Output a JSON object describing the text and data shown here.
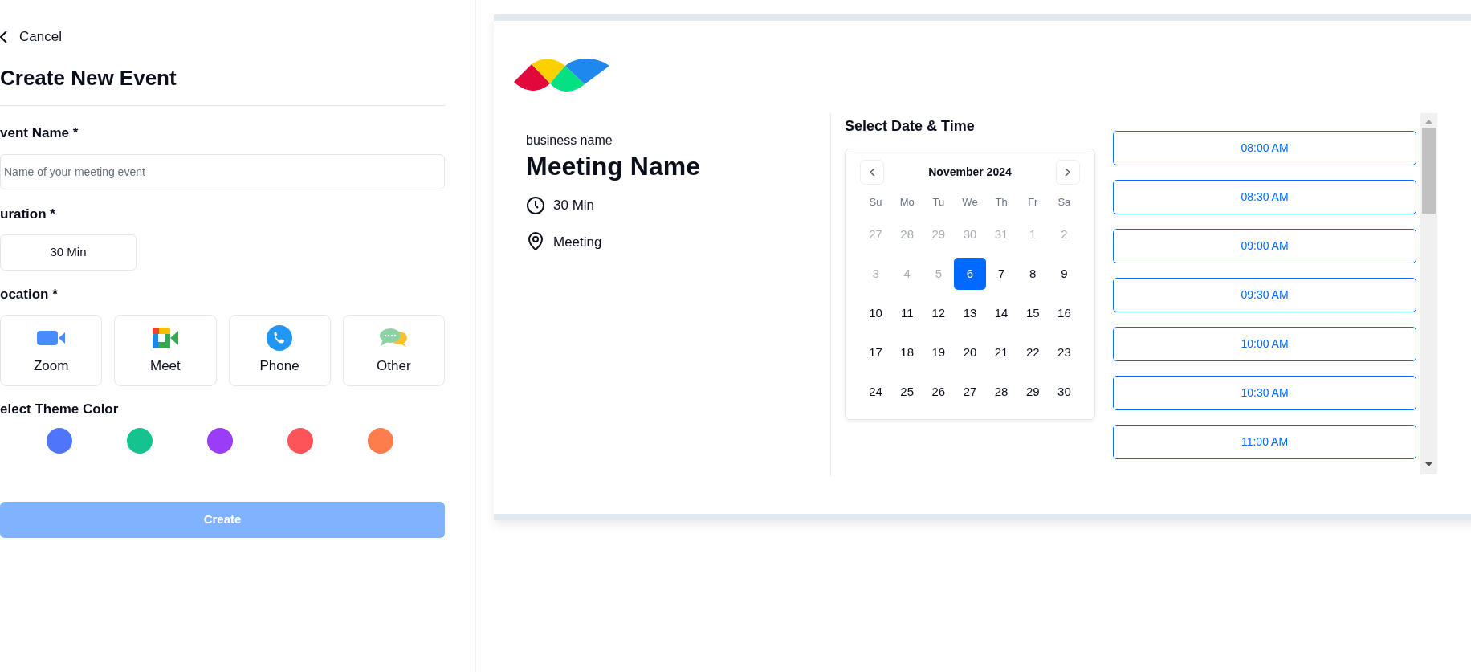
{
  "editor": {
    "back_link": "Cancel",
    "title": "Create New Event",
    "event_name": {
      "label": "vent Name *",
      "placeholder": "Name of your meeting event"
    },
    "duration": {
      "label": "uration *",
      "value": "30 Min"
    },
    "location": {
      "label": "ocation *",
      "options": [
        {
          "kind": "zoom",
          "label": "Zoom",
          "selected": false
        },
        {
          "kind": "meet",
          "label": "Meet",
          "selected": false
        },
        {
          "kind": "phone",
          "label": "Phone",
          "selected": false
        },
        {
          "kind": "other",
          "label": "Other",
          "selected": false
        }
      ]
    },
    "theme": {
      "label": "elect Theme Color",
      "colors": [
        {
          "color": "#4f75fb"
        },
        {
          "color": "#14c38e"
        },
        {
          "color": "#9b3cf8"
        },
        {
          "color": "#fd5459"
        },
        {
          "color": "#fe7d4d"
        }
      ]
    },
    "create_button": {
      "label": "Create",
      "disabled": true
    }
  },
  "preview": {
    "business_name": "business name",
    "meeting_name": "Meeting Name",
    "details": [
      {
        "kind": "clock",
        "text": "30 Min"
      },
      {
        "kind": "pin",
        "text": "Meeting"
      }
    ],
    "heading": "Select Date & Time",
    "calendar": {
      "month": "November 2024",
      "weekdays": [
        "Su",
        "Mo",
        "Tu",
        "We",
        "Th",
        "Fr",
        "Sa"
      ],
      "weeks": [
        [
          {
            "label": "27",
            "muted": true,
            "selected": false
          },
          {
            "label": "28",
            "muted": true,
            "selected": false
          },
          {
            "label": "29",
            "muted": true,
            "selected": false
          },
          {
            "label": "30",
            "muted": true,
            "selected": false
          },
          {
            "label": "31",
            "muted": true,
            "selected": false
          },
          {
            "label": "1",
            "muted": true,
            "selected": false
          },
          {
            "label": "2",
            "muted": true,
            "selected": false
          }
        ],
        [
          {
            "label": "3",
            "muted": true,
            "selected": false
          },
          {
            "label": "4",
            "muted": true,
            "selected": false
          },
          {
            "label": "5",
            "muted": true,
            "selected": false
          },
          {
            "label": "6",
            "muted": false,
            "selected": true
          },
          {
            "label": "7",
            "muted": false,
            "selected": false
          },
          {
            "label": "8",
            "muted": false,
            "selected": false
          },
          {
            "label": "9",
            "muted": false,
            "selected": false
          }
        ],
        [
          {
            "label": "10",
            "muted": false,
            "selected": false
          },
          {
            "label": "11",
            "muted": false,
            "selected": false
          },
          {
            "label": "12",
            "muted": false,
            "selected": false
          },
          {
            "label": "13",
            "muted": false,
            "selected": false
          },
          {
            "label": "14",
            "muted": false,
            "selected": false
          },
          {
            "label": "15",
            "muted": false,
            "selected": false
          },
          {
            "label": "16",
            "muted": false,
            "selected": false
          }
        ],
        [
          {
            "label": "17",
            "muted": false,
            "selected": false
          },
          {
            "label": "18",
            "muted": false,
            "selected": false
          },
          {
            "label": "19",
            "muted": false,
            "selected": false
          },
          {
            "label": "20",
            "muted": false,
            "selected": false
          },
          {
            "label": "21",
            "muted": false,
            "selected": false
          },
          {
            "label": "22",
            "muted": false,
            "selected": false
          },
          {
            "label": "23",
            "muted": false,
            "selected": false
          }
        ],
        [
          {
            "label": "24",
            "muted": false,
            "selected": false
          },
          {
            "label": "25",
            "muted": false,
            "selected": false
          },
          {
            "label": "26",
            "muted": false,
            "selected": false
          },
          {
            "label": "27",
            "muted": false,
            "selected": false
          },
          {
            "label": "28",
            "muted": false,
            "selected": false
          },
          {
            "label": "29",
            "muted": false,
            "selected": false
          },
          {
            "label": "30",
            "muted": false,
            "selected": false
          }
        ]
      ]
    },
    "time_slots": [
      "08:00 AM",
      "08:30 AM",
      "09:00 AM",
      "09:30 AM",
      "10:00 AM",
      "10:30 AM",
      "11:00 AM"
    ]
  }
}
